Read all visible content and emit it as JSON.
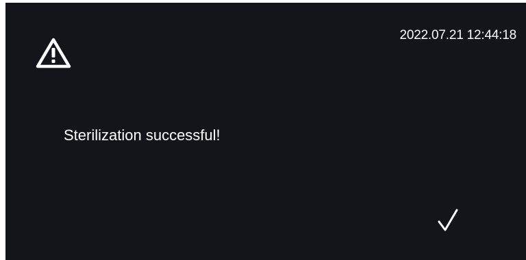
{
  "header": {
    "datetime": "2022.07.21  12:44:18"
  },
  "dialog": {
    "icon": "warning-triangle-icon",
    "message": "Sterilization successful!",
    "confirm_icon": "checkmark-icon"
  },
  "colors": {
    "background": "#14151b",
    "foreground": "#ffffff"
  }
}
